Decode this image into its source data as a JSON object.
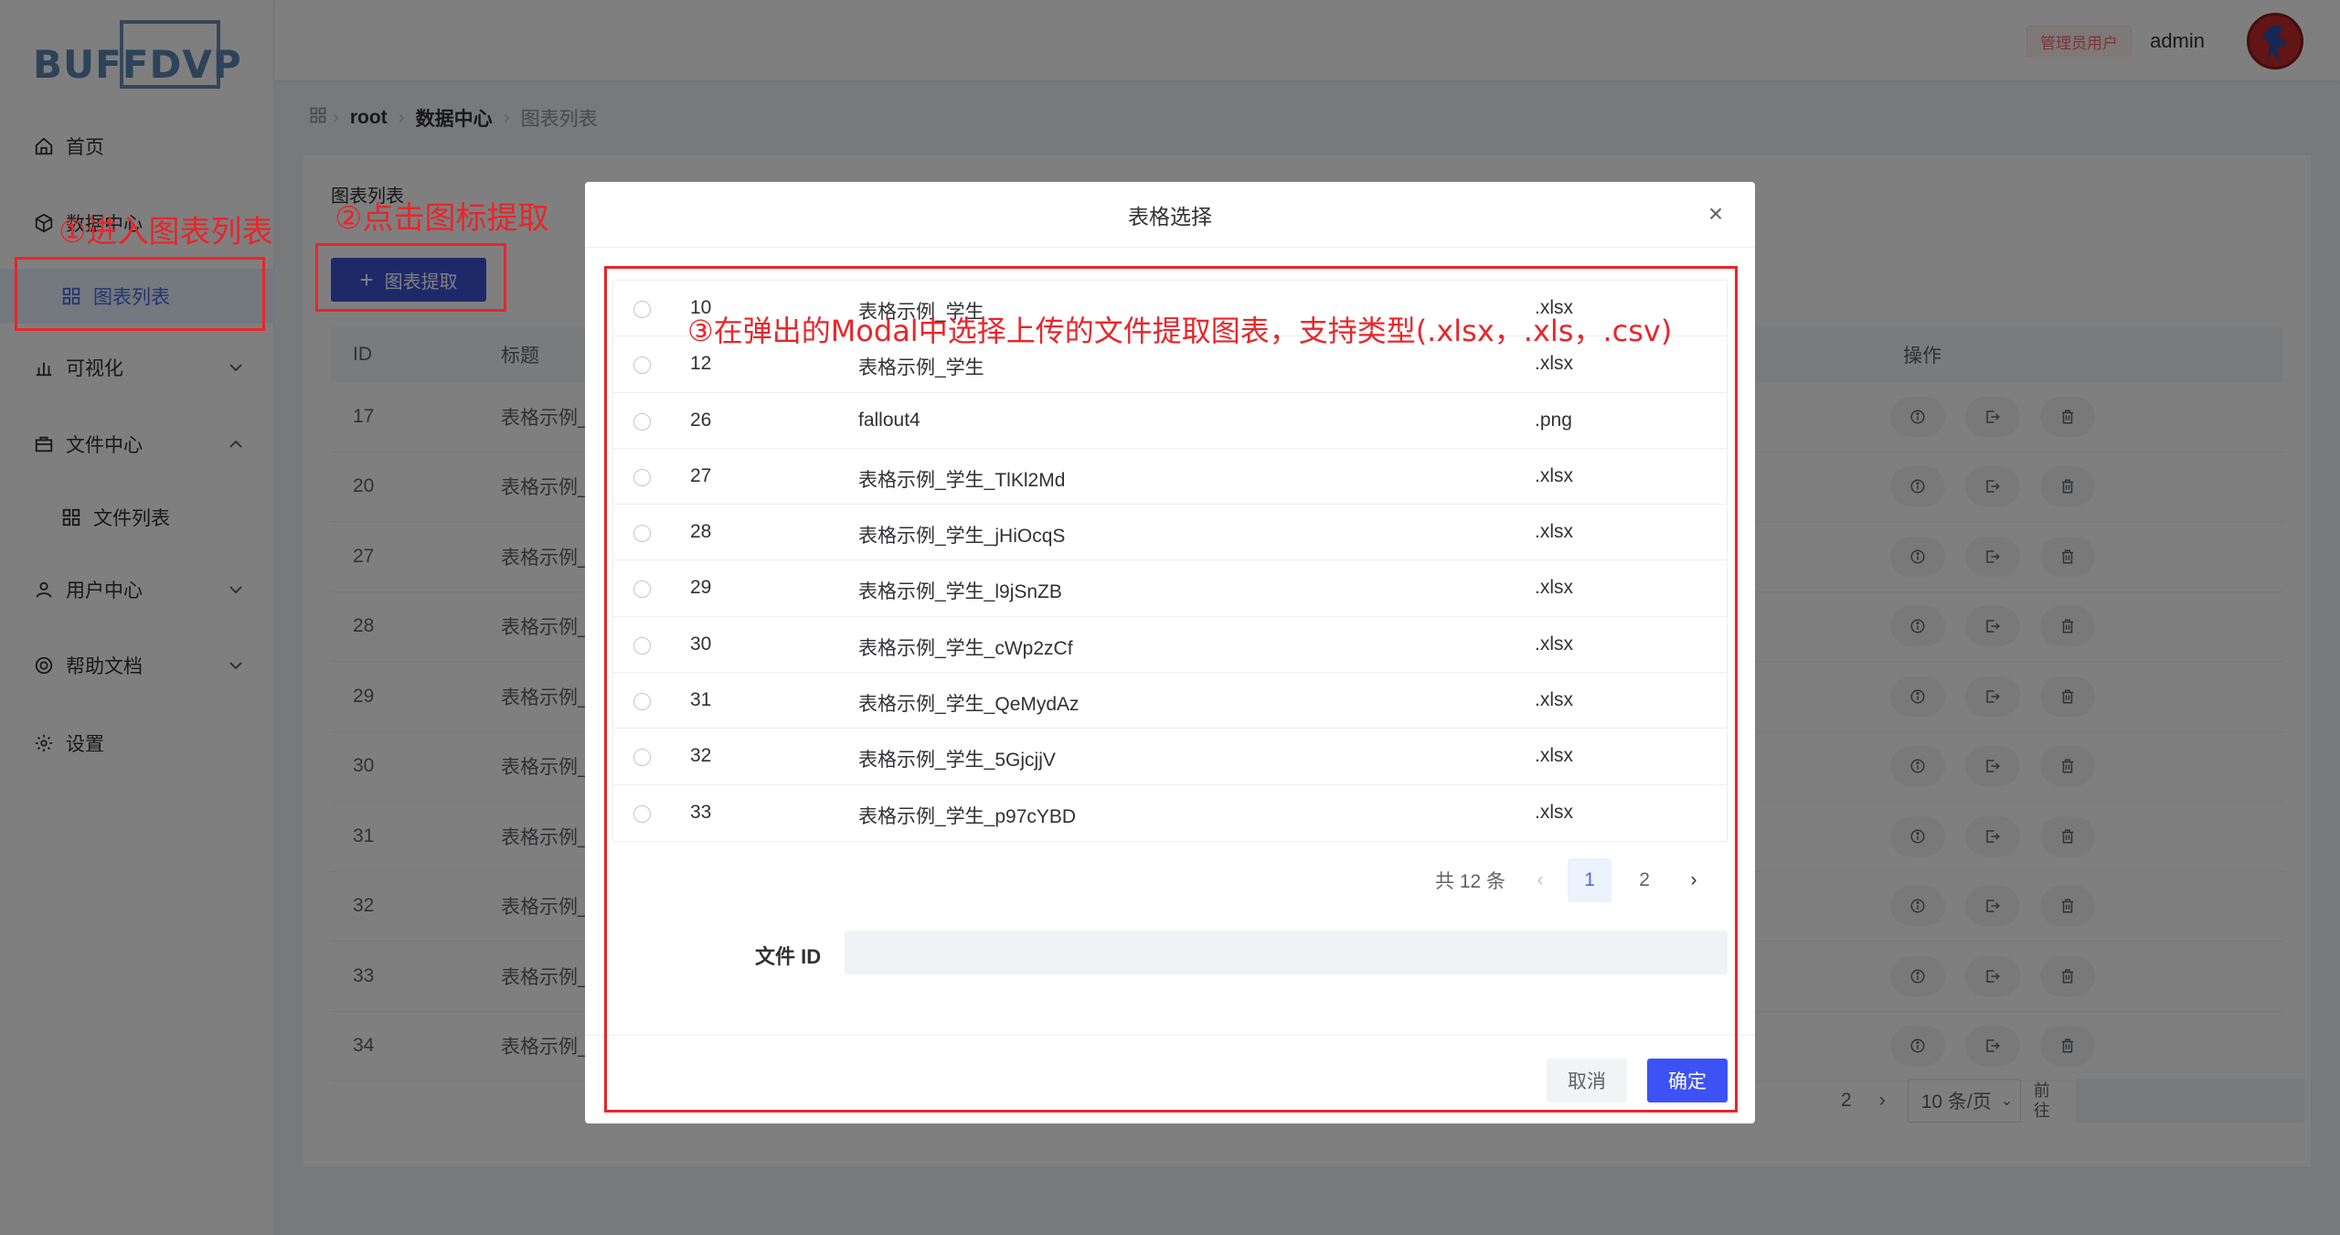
{
  "app": {
    "logo_text": "BUFFDVP",
    "role_badge": "管理员用户",
    "username": "admin"
  },
  "sidebar": {
    "items": [
      {
        "label": "首页",
        "icon": "home-icon"
      },
      {
        "label": "数据中心",
        "icon": "cube-icon"
      },
      {
        "label": "图表列表",
        "icon": "grid-icon",
        "active": true
      },
      {
        "label": "可视化",
        "icon": "bar-chart-icon"
      },
      {
        "label": "文件中心",
        "icon": "briefcase-icon"
      },
      {
        "label": "文件列表",
        "icon": "grid-icon"
      },
      {
        "label": "用户中心",
        "icon": "user-icon"
      },
      {
        "label": "帮助文档",
        "icon": "help-ring-icon"
      },
      {
        "label": "设置",
        "icon": "gear-icon"
      }
    ]
  },
  "breadcrumb": [
    "root",
    "数据中心",
    "图表列表"
  ],
  "card": {
    "title": "图表列表",
    "extract_button": "图表提取",
    "columns": {
      "id": "ID",
      "title": "标题",
      "ops": "操作"
    },
    "rows": [
      {
        "id": "17",
        "title": "表格示例_"
      },
      {
        "id": "20",
        "title": "表格示例_"
      },
      {
        "id": "27",
        "title": "表格示例_"
      },
      {
        "id": "28",
        "title": "表格示例_"
      },
      {
        "id": "29",
        "title": "表格示例_"
      },
      {
        "id": "30",
        "title": "表格示例_"
      },
      {
        "id": "31",
        "title": "表格示例_"
      },
      {
        "id": "32",
        "title": "表格示例_"
      },
      {
        "id": "33",
        "title": "表格示例_"
      },
      {
        "id": "34",
        "title": "表格示例_"
      }
    ],
    "pager": {
      "page2": "2",
      "page_size": "10 条/页",
      "goto": "前往"
    }
  },
  "annotations": {
    "step1": "①进入图表列表",
    "step2": "②点击图标提取",
    "step3": "③在弹出的Modal中选择上传的文件提取图表，支持类型(.xlsx，.xls，.csv)",
    "color": "#e8262a"
  },
  "modal": {
    "title": "表格选择",
    "close": "×",
    "files": [
      {
        "id": "10",
        "name": "表格示例_学生",
        "type": ".xlsx"
      },
      {
        "id": "12",
        "name": "表格示例_学生",
        "type": ".xlsx"
      },
      {
        "id": "26",
        "name": "fallout4",
        "type": ".png"
      },
      {
        "id": "27",
        "name": "表格示例_学生_TlKl2Md",
        "type": ".xlsx"
      },
      {
        "id": "28",
        "name": "表格示例_学生_jHiOcqS",
        "type": ".xlsx"
      },
      {
        "id": "29",
        "name": "表格示例_学生_l9jSnZB",
        "type": ".xlsx"
      },
      {
        "id": "30",
        "name": "表格示例_学生_cWp2zCf",
        "type": ".xlsx"
      },
      {
        "id": "31",
        "name": "表格示例_学生_QeMydAz",
        "type": ".xlsx"
      },
      {
        "id": "32",
        "name": "表格示例_学生_5GjcjjV",
        "type": ".xlsx"
      },
      {
        "id": "33",
        "name": "表格示例_学生_p97cYBD",
        "type": ".xlsx"
      }
    ],
    "pager": {
      "total": "共 12 条",
      "pages": [
        "1",
        "2"
      ],
      "current": "1"
    },
    "form_label": "文件 ID",
    "form_value": "",
    "cancel": "取消",
    "ok": "确定"
  },
  "colors": {
    "primary": "#3d52f5",
    "danger": "#e8262a"
  }
}
